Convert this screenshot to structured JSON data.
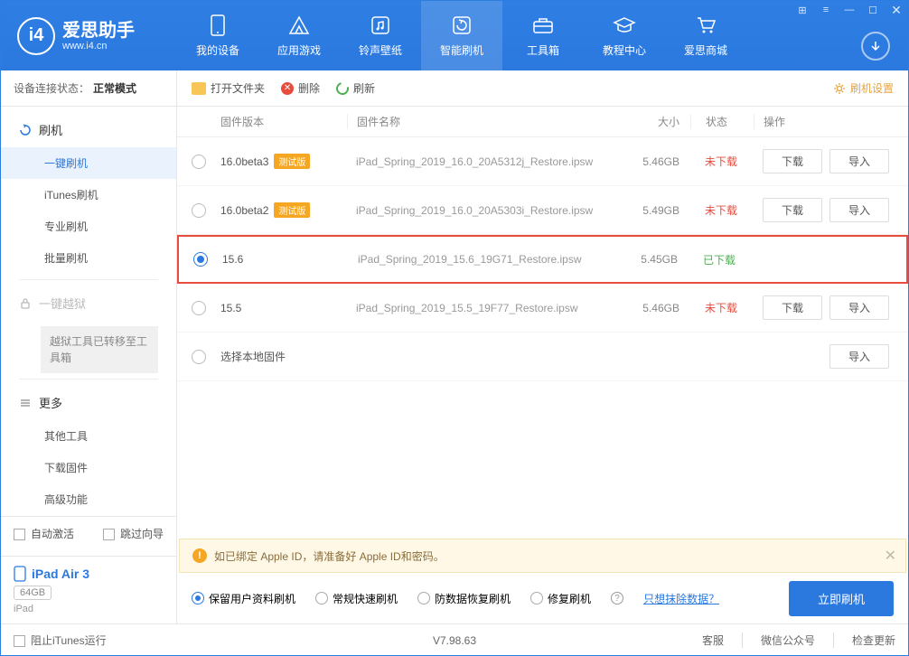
{
  "brand": {
    "name": "爱思助手",
    "url": "www.i4.cn"
  },
  "topnav": [
    {
      "label": "我的设备"
    },
    {
      "label": "应用游戏"
    },
    {
      "label": "铃声壁纸"
    },
    {
      "label": "智能刷机"
    },
    {
      "label": "工具箱"
    },
    {
      "label": "教程中心"
    },
    {
      "label": "爱思商城"
    }
  ],
  "sidebar": {
    "status_label": "设备连接状态：",
    "status_value": "正常模式",
    "groups": {
      "flash": "刷机",
      "jailbreak": "一键越狱",
      "more": "更多"
    },
    "flash_items": [
      "一键刷机",
      "iTunes刷机",
      "专业刷机",
      "批量刷机"
    ],
    "jailbreak_note": "越狱工具已转移至工具箱",
    "more_items": [
      "其他工具",
      "下载固件",
      "高级功能"
    ],
    "auto_activate": "自动激活",
    "skip_guide": "跳过向导"
  },
  "device": {
    "name": "iPad Air 3",
    "storage": "64GB",
    "type": "iPad"
  },
  "toolbar": {
    "open_folder": "打开文件夹",
    "delete": "删除",
    "refresh": "刷新",
    "settings": "刷机设置"
  },
  "table": {
    "headers": {
      "version": "固件版本",
      "name": "固件名称",
      "size": "大小",
      "status": "状态",
      "action": "操作"
    },
    "rows": [
      {
        "version": "16.0beta3",
        "beta": "测试版",
        "name": "iPad_Spring_2019_16.0_20A5312j_Restore.ipsw",
        "size": "5.46GB",
        "status": "未下载",
        "downloaded": false,
        "selected": false
      },
      {
        "version": "16.0beta2",
        "beta": "测试版",
        "name": "iPad_Spring_2019_16.0_20A5303i_Restore.ipsw",
        "size": "5.49GB",
        "status": "未下载",
        "downloaded": false,
        "selected": false
      },
      {
        "version": "15.6",
        "beta": "",
        "name": "iPad_Spring_2019_15.6_19G71_Restore.ipsw",
        "size": "5.45GB",
        "status": "已下载",
        "downloaded": true,
        "selected": true
      },
      {
        "version": "15.5",
        "beta": "",
        "name": "iPad_Spring_2019_15.5_19F77_Restore.ipsw",
        "size": "5.46GB",
        "status": "未下载",
        "downloaded": false,
        "selected": false
      }
    ],
    "local_label": "选择本地固件",
    "download_btn": "下载",
    "import_btn": "导入"
  },
  "warning": "如已绑定 Apple ID，请准备好 Apple ID和密码。",
  "flash_options": {
    "opts": [
      "保留用户资料刷机",
      "常规快速刷机",
      "防数据恢复刷机",
      "修复刷机"
    ],
    "erase_link": "只想抹除数据？",
    "flash_btn": "立即刷机"
  },
  "statusbar": {
    "block_itunes": "阻止iTunes运行",
    "version": "V7.98.63",
    "links": [
      "客服",
      "微信公众号",
      "检查更新"
    ]
  }
}
